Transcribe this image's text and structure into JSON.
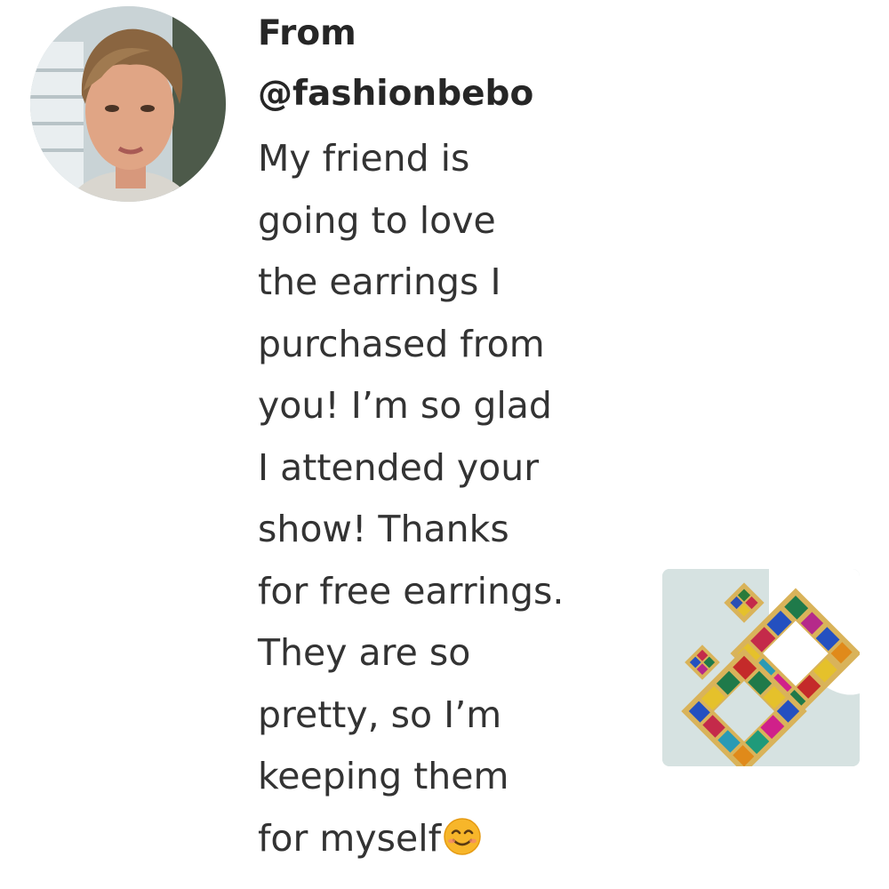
{
  "sender": {
    "avatar_icon": "profile-photo",
    "from_label": "From",
    "username": "@fashionbebo"
  },
  "message": {
    "lines": [
      "My friend is",
      "going to love",
      "the earrings I",
      "purchased from",
      "you! I’m so glad",
      "I attended your",
      "show! Thanks",
      "for free earrings.",
      "They are so",
      "pretty, so I’m",
      "keeping them",
      "for myself"
    ],
    "trailing_emoji": "smiling-face-emoji"
  },
  "product": {
    "image_icon": "earrings-photo"
  },
  "colors": {
    "text": "#333333",
    "background": "#ffffff",
    "emoji_yellow": "#f7b62a"
  }
}
